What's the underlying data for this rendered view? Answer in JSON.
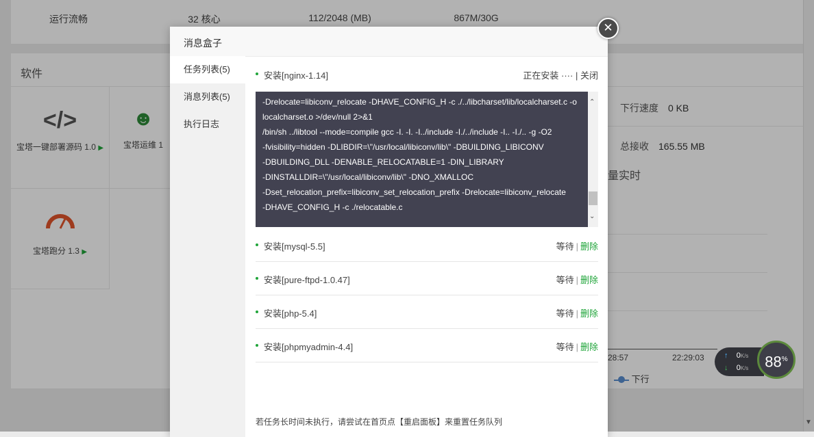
{
  "background": {
    "stats": [
      "运行流畅",
      "32 核心",
      "112/2048 (MB)",
      "867M/30G"
    ],
    "software_title": "软件",
    "software_items": [
      {
        "label": "宝塔一键部署源码 1.0",
        "icon": "code-icon"
      },
      {
        "label": "宝塔运维 1",
        "icon": "operator-icon"
      },
      {
        "label": "宝塔跑分 1.3",
        "icon": "speedometer-icon"
      }
    ],
    "network": {
      "down_speed_label": "下行速度",
      "down_speed_value": "0 KB",
      "total_recv_label": "总接收",
      "total_recv_value": "165.55 MB",
      "realtime_label": "量实时",
      "times": [
        "28:57",
        "22:29:03"
      ],
      "legend_down": "下行"
    },
    "speed_widget": {
      "up": "0",
      "down": "0",
      "unit": "K/s",
      "percent": "88",
      "percent_unit": "%"
    }
  },
  "modal": {
    "title": "消息盒子",
    "close_glyph": "✕",
    "sidebar": [
      {
        "label": "任务列表(5)",
        "active": true
      },
      {
        "label": "消息列表(5)",
        "active": false
      },
      {
        "label": "执行日志",
        "active": false
      }
    ],
    "current_task": {
      "name": "安装[nginx-1.14]",
      "status": "正在安装 ····",
      "sep": "|",
      "close": "关闭"
    },
    "log_lines": [
      "-Drelocate=libiconv_relocate -DHAVE_CONFIG_H -c ./../libcharset/lib/localcharset.c -o",
      "localcharset.o >/dev/null 2>&1",
      "/bin/sh ../libtool --mode=compile gcc -I. -I. -I../include -I./../include -I.. -I./.. -g -O2",
      "-fvisibility=hidden -DLIBDIR=\\\"/usr/local/libiconv/lib\\\" -DBUILDING_LIBICONV",
      "-DBUILDING_DLL -DENABLE_RELOCATABLE=1 -DIN_LIBRARY",
      "-DINSTALLDIR=\\\"/usr/local/libiconv/lib\\\" -DNO_XMALLOC",
      "-Dset_relocation_prefix=libiconv_set_relocation_prefix -Drelocate=libiconv_relocate",
      "-DHAVE_CONFIG_H -c ./relocatable.c"
    ],
    "queued_tasks": [
      {
        "name": "安装[mysql-5.5]",
        "status": "等待",
        "sep": "|",
        "delete": "删除"
      },
      {
        "name": "安装[pure-ftpd-1.0.47]",
        "status": "等待",
        "sep": "|",
        "delete": "删除"
      },
      {
        "name": "安装[php-5.4]",
        "status": "等待",
        "sep": "|",
        "delete": "删除"
      },
      {
        "name": "安装[phpmyadmin-4.4]",
        "status": "等待",
        "sep": "|",
        "delete": "删除"
      }
    ],
    "footer_tip": "若任务长时间未执行，请尝试在首页点【重启面板】来重置任务队列"
  },
  "colors": {
    "accent": "#20a53a",
    "log_bg": "#424251"
  }
}
